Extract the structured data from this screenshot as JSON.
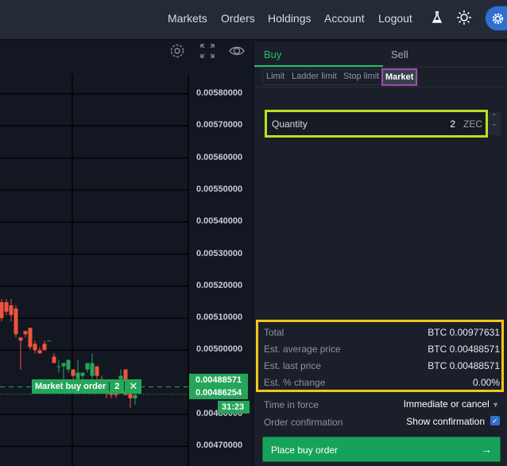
{
  "nav": {
    "items": [
      "Markets",
      "Orders",
      "Holdings",
      "Account",
      "Logout"
    ],
    "icons": [
      "flask-icon",
      "sun-icon",
      "settings-gear-icon"
    ]
  },
  "chart": {
    "toolbar_icons": [
      "gear-icon",
      "fullscreen-icon",
      "eye-icon"
    ],
    "order_line": {
      "label": "Market buy order",
      "quantity": "2",
      "close": "✕"
    },
    "price_tags": {
      "order_price": "0.00488571",
      "last_price": "0.00486254",
      "countdown": "31:23"
    }
  },
  "chart_data": {
    "type": "candlestick",
    "y_ticks": [
      "0.00580000",
      "0.00570000",
      "0.00560000",
      "0.00550000",
      "0.00540000",
      "0.00530000",
      "0.00520000",
      "0.00510000",
      "0.00500000",
      "0.00480000",
      "0.00470000"
    ],
    "ylim": [
      0.00466,
      0.0059
    ],
    "order_price": 0.00488571,
    "last_price": 0.00486254,
    "candles": [
      {
        "o": 0.00515,
        "h": 0.00516,
        "l": 0.00509,
        "c": 0.0051
      },
      {
        "o": 0.00515,
        "h": 0.00516,
        "l": 0.00511,
        "c": 0.00512
      },
      {
        "o": 0.00514,
        "h": 0.00516,
        "l": 0.00509,
        "c": 0.00511
      },
      {
        "o": 0.00513,
        "h": 0.00514,
        "l": 0.00504,
        "c": 0.00505
      },
      {
        "o": 0.00504,
        "h": 0.00504,
        "l": 0.00494,
        "c": 0.00503
      },
      {
        "o": 0.00506,
        "h": 0.00506,
        "l": 0.00504,
        "c": 0.00505
      },
      {
        "o": 0.00507,
        "h": 0.00507,
        "l": 0.005,
        "c": 0.00501
      },
      {
        "o": 0.00502,
        "h": 0.00503,
        "l": 0.00499,
        "c": 0.005
      },
      {
        "o": 0.005,
        "h": 0.00501,
        "l": 0.00499,
        "c": 0.00499
      },
      {
        "o": 0.00502,
        "h": 0.00503,
        "l": 0.00501,
        "c": 0.005
      },
      {
        "o": 0.00503,
        "h": 0.00503,
        "l": 0.00503,
        "c": 0.00503
      },
      {
        "o": 0.00498,
        "h": 0.00499,
        "l": 0.00496,
        "c": 0.00496
      },
      {
        "o": 0.00495,
        "h": 0.00497,
        "l": 0.00493,
        "c": 0.00495
      },
      {
        "o": 0.00495,
        "h": 0.00496,
        "l": 0.0049,
        "c": 0.00496
      },
      {
        "o": 0.00494,
        "h": 0.00497,
        "l": 0.00493,
        "c": 0.00497
      },
      {
        "o": 0.00494,
        "h": 0.00494,
        "l": 0.0049,
        "c": 0.00492
      },
      {
        "o": 0.00491,
        "h": 0.00497,
        "l": 0.00489,
        "c": 0.00493
      },
      {
        "o": 0.00492,
        "h": 0.00493,
        "l": 0.00489,
        "c": 0.00493
      },
      {
        "o": 0.00494,
        "h": 0.00496,
        "l": 0.00493,
        "c": 0.00496
      },
      {
        "o": 0.00492,
        "h": 0.00499,
        "l": 0.00491,
        "c": 0.00496
      },
      {
        "o": 0.00495,
        "h": 0.00495,
        "l": 0.00491,
        "c": 0.00492
      },
      {
        "o": 0.00491,
        "h": 0.00492,
        "l": 0.00488,
        "c": 0.00489
      },
      {
        "o": 0.00489,
        "h": 0.0049,
        "l": 0.00485,
        "c": 0.00487
      },
      {
        "o": 0.00488,
        "h": 0.00489,
        "l": 0.00485,
        "c": 0.00486
      },
      {
        "o": 0.00487,
        "h": 0.00488,
        "l": 0.00485,
        "c": 0.00486
      },
      {
        "o": 0.00491,
        "h": 0.00494,
        "l": 0.00489,
        "c": 0.00492
      },
      {
        "o": 0.00494,
        "h": 0.00494,
        "l": 0.00486,
        "c": 0.00486
      },
      {
        "o": 0.00487,
        "h": 0.00488,
        "l": 0.00482,
        "c": 0.00485
      },
      {
        "o": 0.00485,
        "h": 0.00487,
        "l": 0.00483,
        "c": 0.00486
      }
    ]
  },
  "panel": {
    "tabs": [
      "Buy",
      "Sell"
    ],
    "order_types": [
      "Limit",
      "Ladder limit",
      "Stop limit",
      "Market"
    ],
    "quantity": {
      "label": "Quantity",
      "value": "2",
      "unit": "ZEC"
    },
    "summary": [
      {
        "label": "Total",
        "currency": "BTC",
        "value": "0.00977631"
      },
      {
        "label": "Est. average price",
        "currency": "BTC",
        "value": "0.00488571"
      },
      {
        "label": "Est. last price",
        "currency": "BTC",
        "value": "0.00488571"
      },
      {
        "label": "Est. % change",
        "currency": "",
        "value": "0.00%"
      }
    ],
    "time_in_force": {
      "label": "Time in force",
      "value": "Immediate or cancel"
    },
    "confirmation": {
      "label": "Order confirmation",
      "value": "Show confirmation",
      "checked": true
    },
    "submit": "Place buy order"
  },
  "colors": {
    "up": "#26a65b",
    "down": "#f0533f",
    "accent": "#1ec26a",
    "button": "#17a25c",
    "highlight_market": "#9b4fb0",
    "highlight_qty": "#b8e21e",
    "highlight_summary": "#f5c518",
    "blue": "#2f6fce"
  }
}
